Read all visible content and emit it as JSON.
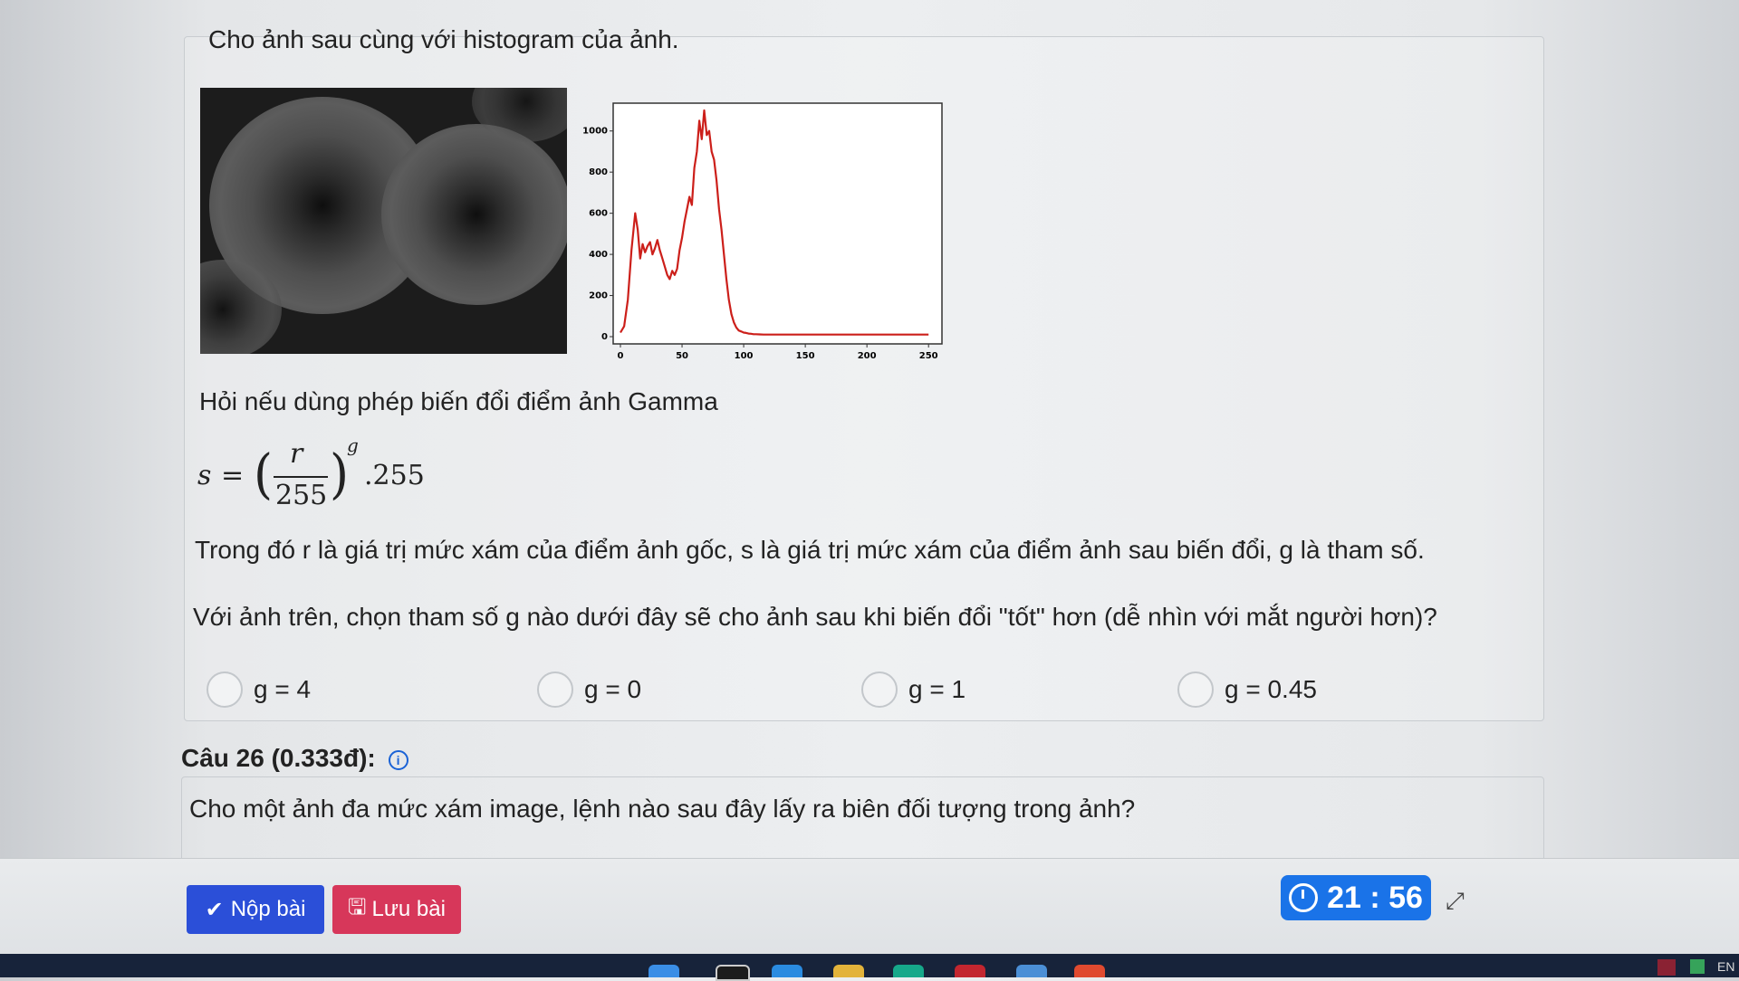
{
  "question": {
    "intro": "Cho ảnh sau cùng với histogram của ảnh.",
    "prompt": "Hỏi nếu dùng phép biến đổi điểm ảnh Gamma",
    "formula": {
      "s": "s",
      "eq": "=",
      "numerator": "r",
      "denominator": "255",
      "exponent": "g",
      "tail": ".255"
    },
    "explanation": "Trong đó r là giá trị mức xám của điểm ảnh gốc, s là giá trị mức xám của điểm ảnh sau biến đổi, g là tham số.",
    "ask": "Với ảnh trên, chọn tham số g nào dưới đây sẽ cho ảnh sau khi biến đổi \"tốt\" hơn (dễ nhìn với mắt người hơn)?",
    "options": [
      "g = 4",
      "g = 0",
      "g = 1",
      "g = 0.45"
    ]
  },
  "chart_data": {
    "type": "line",
    "xlim": [
      0,
      255
    ],
    "ylim": [
      0,
      1100
    ],
    "x_ticks": [
      "0",
      "50",
      "100",
      "150",
      "200",
      "250"
    ],
    "y_ticks": [
      "0",
      "200",
      "400",
      "600",
      "800",
      "1000"
    ],
    "series": [
      {
        "color": "#cc1f1a",
        "x": [
          0,
          3,
          6,
          9,
          12,
          14,
          16,
          18,
          20,
          22,
          24,
          26,
          28,
          30,
          32,
          34,
          36,
          38,
          40,
          42,
          44,
          46,
          48,
          50,
          52,
          54,
          56,
          58,
          60,
          62,
          64,
          66,
          68,
          70,
          72,
          74,
          76,
          78,
          80,
          82,
          84,
          86,
          88,
          90,
          92,
          94,
          96,
          98,
          100,
          102,
          104,
          106,
          108,
          110,
          113,
          116,
          120,
          125,
          130,
          140,
          150,
          160,
          175,
          200,
          225,
          250
        ],
        "y": [
          20,
          50,
          180,
          420,
          600,
          520,
          380,
          450,
          410,
          440,
          460,
          400,
          430,
          470,
          420,
          380,
          340,
          300,
          280,
          320,
          300,
          330,
          420,
          480,
          560,
          620,
          680,
          640,
          820,
          900,
          1050,
          960,
          1100,
          980,
          1000,
          900,
          860,
          760,
          620,
          520,
          400,
          280,
          180,
          110,
          70,
          45,
          30,
          25,
          20,
          18,
          15,
          14,
          12,
          12,
          11,
          10,
          10,
          10,
          10,
          10,
          10,
          10,
          10,
          10,
          10,
          10
        ]
      }
    ]
  },
  "question26": {
    "label": "Câu 26 (0.333đ):",
    "info_icon": "i",
    "text": "Cho một ảnh đa mức xám image, lệnh nào sau đây lấy ra biên đối tượng trong ảnh?"
  },
  "actions": {
    "submit_label": "Nộp bài",
    "save_label": "Lưu bài"
  },
  "timer": {
    "value": "21 : 56"
  },
  "tray": {
    "lang": "EN"
  }
}
